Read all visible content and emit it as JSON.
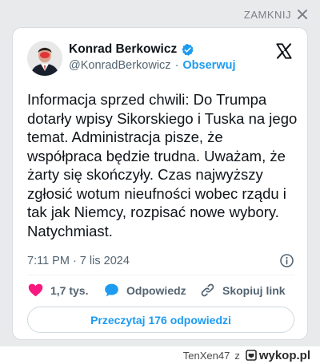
{
  "overlay": {
    "close_label": "ZAMKNIJ"
  },
  "tweet": {
    "author_name": "Konrad Berkowicz",
    "handle": "@KonradBerkowicz",
    "separator": "·",
    "follow_label": "Obserwuj",
    "text": "Informacja sprzed chwili: Do Trumpa dotarły wpisy Sikorskiego i Tuska na jego temat. Administracja pisze, że współpraca będzie trudna. Uważam, że żarty się skończyły. Czas najwyższy zgłosić wotum nieufności wobec rządu i tak jak Niemcy, rozpisać nowe wybory. Natychmiast.",
    "timestamp": "7:11 PM · 7 lis 2024",
    "likes": "1,7 tys.",
    "reply_label": "Odpowiedz",
    "copy_link_label": "Skopiuj link",
    "read_replies_label": "Przeczytaj 176 odpowiedzi"
  },
  "footer": {
    "username": "TenXen47",
    "connector": "z",
    "site": "wykop.pl"
  },
  "colors": {
    "accent": "#1d9bf0",
    "like": "#f91880",
    "text": "#0f1419",
    "muted": "#536471",
    "backdrop": "#e9eaec"
  },
  "icons": [
    "close-icon",
    "verified-badge-icon",
    "x-logo-icon",
    "info-icon",
    "heart-icon",
    "speech-bubble-icon",
    "link-icon",
    "wykop-logo-icon"
  ]
}
